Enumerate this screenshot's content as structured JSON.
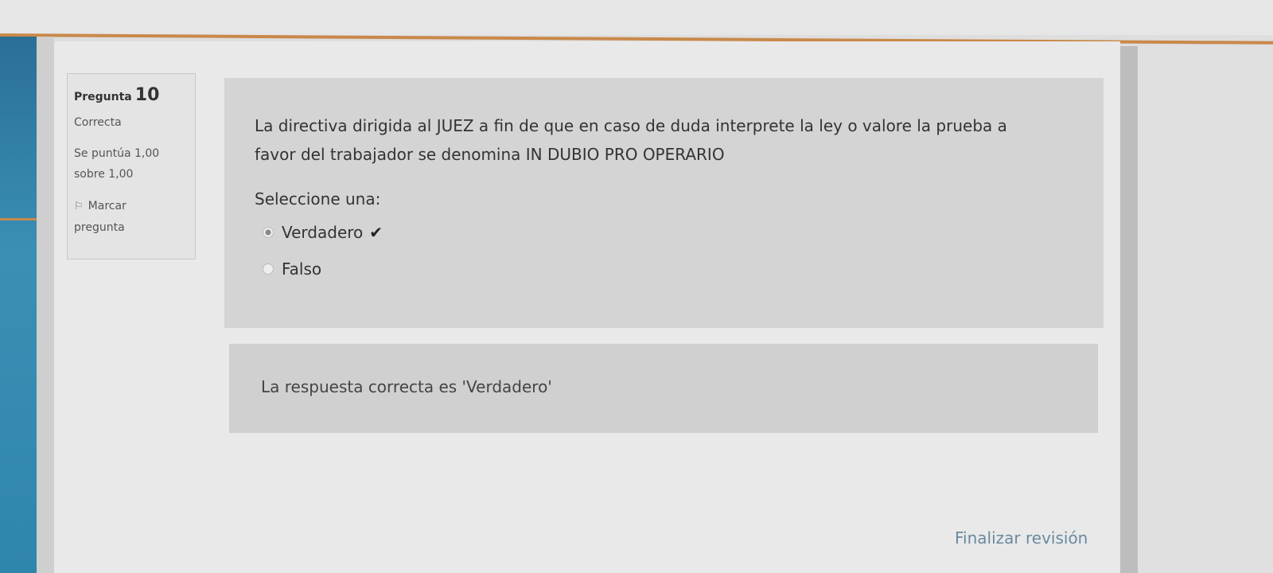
{
  "question": {
    "label": "Pregunta",
    "number": "10",
    "state": "Correcta",
    "grade_line1": "Se puntúa 1,00",
    "grade_line2": "sobre 1,00",
    "flag_line1": "Marcar",
    "flag_line2": "pregunta",
    "flag_icon": "flag-icon",
    "text_line1": "La directiva dirigida al JUEZ a fin de que en caso de duda interprete la ley o valore la prueba a",
    "text_line2": "favor del trabajador se denomina IN DUBIO PRO OPERARIO",
    "prompt": "Seleccione una:",
    "options": [
      {
        "label": "Verdadero",
        "selected": true,
        "correct_icon": "checkmark-icon"
      },
      {
        "label": "Falso",
        "selected": false
      }
    ]
  },
  "feedback": {
    "text": "La respuesta correcta es 'Verdadero'"
  },
  "footer": {
    "finish_label": "Finalizar revisión"
  },
  "colors": {
    "accent_orange": "#c9894a",
    "sidebar_blue": "#2f86ad",
    "link": "#6a8aa0"
  }
}
